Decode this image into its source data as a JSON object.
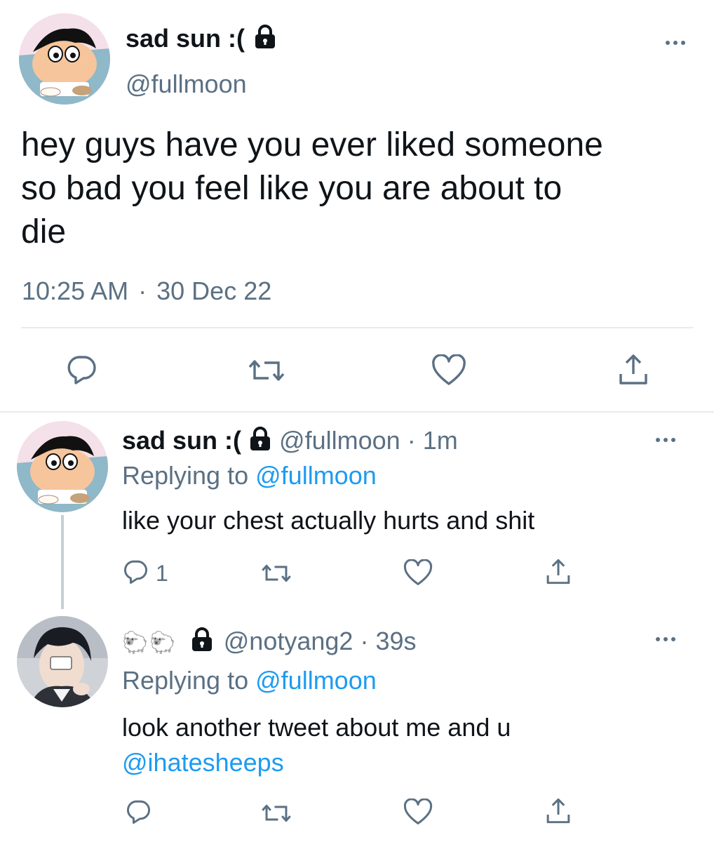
{
  "main_tweet": {
    "display_name": "sad sun :(",
    "handle": "@fullmoon",
    "text_lines": [
      "hey guys have you ever liked someone",
      "so bad you feel like you are about to",
      "die"
    ],
    "time": "10:25 AM",
    "separator": "·",
    "date": "30 Dec 22"
  },
  "replies": [
    {
      "display_name": "sad sun :(",
      "handle": "@fullmoon",
      "separator": "·",
      "age": "1m",
      "replying_prefix": "Replying to",
      "replying_handle": "@fullmoon",
      "text": "like your chest actually hurts and shit",
      "reply_count": "1"
    },
    {
      "display_name_emoji": "🐑🐑",
      "handle": "@notyang2",
      "separator": "·",
      "age": "39s",
      "replying_prefix": "Replying to",
      "replying_handle": "@fullmoon",
      "text": "look another tweet about me and u",
      "mention": "@ihatesheeps"
    }
  ],
  "colors": {
    "text": "#0f1419",
    "muted": "#5b7083",
    "link": "#1d9bf0",
    "divider": "#e6ecf0"
  },
  "icons": [
    "lock-icon",
    "more-icon",
    "reply-icon",
    "retweet-icon",
    "like-icon",
    "share-icon"
  ]
}
